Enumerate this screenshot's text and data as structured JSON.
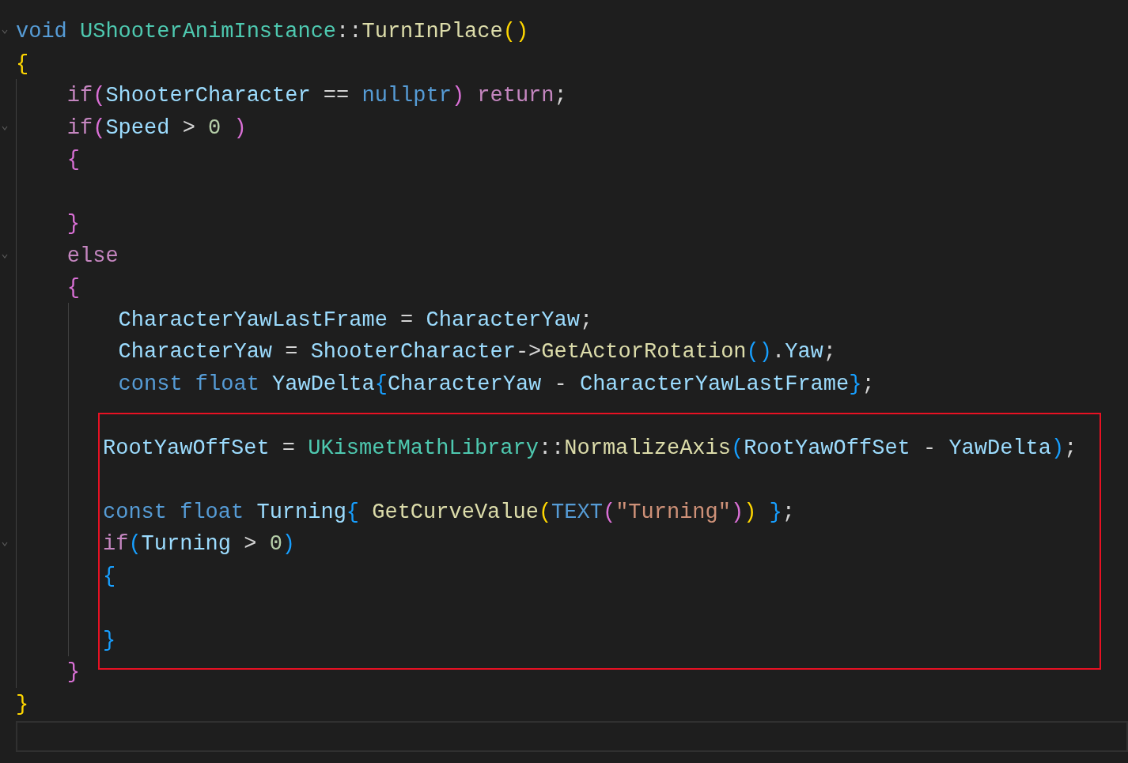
{
  "editor": {
    "sections": [
      {
        "highlighted": false,
        "lines": [
          {
            "fold": true,
            "current": false,
            "tokens": [
              {
                "text": "void ",
                "kind": "keyword"
              },
              {
                "text": "UShooterAnimInstance",
                "kind": "type"
              },
              {
                "text": "::",
                "kind": "plain"
              },
              {
                "text": "TurnInPlace",
                "kind": "function"
              },
              {
                "text": "()",
                "kind": "bracket1"
              }
            ]
          },
          {
            "fold": false,
            "current": false,
            "tokens": [
              {
                "text": "{",
                "kind": "bracket1"
              }
            ]
          },
          {
            "fold": false,
            "current": false,
            "tokens": [
              {
                "text": "    if",
                "kind": "control"
              },
              {
                "text": "(",
                "kind": "bracket2"
              },
              {
                "text": "ShooterCharacter",
                "kind": "variable"
              },
              {
                "text": " == ",
                "kind": "plain"
              },
              {
                "text": "nullptr",
                "kind": "keyword"
              },
              {
                "text": ")",
                "kind": "bracket2"
              },
              {
                "text": " return",
                "kind": "control"
              },
              {
                "text": ";",
                "kind": "plain"
              }
            ]
          },
          {
            "fold": true,
            "current": false,
            "tokens": [
              {
                "text": "    if",
                "kind": "control"
              },
              {
                "text": "(",
                "kind": "bracket2"
              },
              {
                "text": "Speed",
                "kind": "variable"
              },
              {
                "text": " > ",
                "kind": "plain"
              },
              {
                "text": "0",
                "kind": "number"
              },
              {
                "text": " )",
                "kind": "bracket2"
              }
            ]
          },
          {
            "fold": false,
            "current": false,
            "tokens": [
              {
                "text": "    {",
                "kind": "bracket2"
              }
            ]
          },
          {
            "fold": false,
            "current": false
          },
          {
            "fold": false,
            "current": false,
            "tokens": [
              {
                "text": "    }",
                "kind": "bracket2"
              }
            ]
          },
          {
            "fold": true,
            "current": false,
            "tokens": [
              {
                "text": "    else",
                "kind": "control"
              }
            ]
          },
          {
            "fold": false,
            "current": false,
            "tokens": [
              {
                "text": "    {",
                "kind": "bracket2"
              }
            ]
          },
          {
            "fold": false,
            "current": false,
            "tokens": [
              {
                "text": "        CharacterYawLastFrame",
                "kind": "variable"
              },
              {
                "text": " = ",
                "kind": "plain"
              },
              {
                "text": "CharacterYaw",
                "kind": "variable"
              },
              {
                "text": ";",
                "kind": "plain"
              }
            ]
          },
          {
            "fold": false,
            "current": false,
            "tokens": [
              {
                "text": "        CharacterYaw",
                "kind": "variable"
              },
              {
                "text": " = ",
                "kind": "plain"
              },
              {
                "text": "ShooterCharacter",
                "kind": "variable"
              },
              {
                "text": "->",
                "kind": "plain"
              },
              {
                "text": "GetActorRotation",
                "kind": "function"
              },
              {
                "text": "()",
                "kind": "bracket3"
              },
              {
                "text": ".",
                "kind": "plain"
              },
              {
                "text": "Yaw",
                "kind": "variable"
              },
              {
                "text": ";",
                "kind": "plain"
              }
            ]
          },
          {
            "fold": false,
            "current": false,
            "tokens": [
              {
                "text": "        const ",
                "kind": "keyword"
              },
              {
                "text": "float ",
                "kind": "keyword"
              },
              {
                "text": "YawDelta",
                "kind": "variable"
              },
              {
                "text": "{",
                "kind": "bracket3"
              },
              {
                "text": "CharacterYaw",
                "kind": "variable"
              },
              {
                "text": " - ",
                "kind": "plain"
              },
              {
                "text": "CharacterYawLastFrame",
                "kind": "variable"
              },
              {
                "text": "}",
                "kind": "bracket3"
              },
              {
                "text": ";",
                "kind": "plain"
              }
            ]
          }
        ]
      },
      {
        "highlighted": true,
        "lines": [
          {
            "fold": false,
            "current": false
          },
          {
            "fold": false,
            "current": false,
            "tokens": [
              {
                "text": "RootYawOffSet",
                "kind": "variable"
              },
              {
                "text": " = ",
                "kind": "plain"
              },
              {
                "text": "UKismetMathLibrary",
                "kind": "type"
              },
              {
                "text": "::",
                "kind": "plain"
              },
              {
                "text": "NormalizeAxis",
                "kind": "function"
              },
              {
                "text": "(",
                "kind": "bracket3"
              },
              {
                "text": "RootYawOffSet",
                "kind": "variable"
              },
              {
                "text": " - ",
                "kind": "plain"
              },
              {
                "text": "YawDelta",
                "kind": "variable"
              },
              {
                "text": ")",
                "kind": "bracket3"
              },
              {
                "text": ";",
                "kind": "plain"
              }
            ]
          },
          {
            "fold": false,
            "current": false
          },
          {
            "fold": false,
            "current": false,
            "tokens": [
              {
                "text": "const ",
                "kind": "keyword"
              },
              {
                "text": "float ",
                "kind": "keyword"
              },
              {
                "text": "Turning",
                "kind": "variable"
              },
              {
                "text": "{ ",
                "kind": "bracket3"
              },
              {
                "text": "GetCurveValue",
                "kind": "function"
              },
              {
                "text": "(",
                "kind": "bracket1"
              },
              {
                "text": "TEXT",
                "kind": "keyword"
              },
              {
                "text": "(",
                "kind": "bracket2"
              },
              {
                "text": "\"Turning\"",
                "kind": "string"
              },
              {
                "text": ")",
                "kind": "bracket2"
              },
              {
                "text": ")",
                "kind": "bracket1"
              },
              {
                "text": " }",
                "kind": "bracket3"
              },
              {
                "text": ";",
                "kind": "plain"
              }
            ]
          },
          {
            "fold": true,
            "current": false,
            "tokens": [
              {
                "text": "if",
                "kind": "control"
              },
              {
                "text": "(",
                "kind": "bracket3"
              },
              {
                "text": "Turning",
                "kind": "variable"
              },
              {
                "text": " > ",
                "kind": "plain"
              },
              {
                "text": "0",
                "kind": "number"
              },
              {
                "text": ")",
                "kind": "bracket3"
              }
            ]
          },
          {
            "fold": false,
            "current": false,
            "tokens": [
              {
                "text": "{",
                "kind": "bracket3"
              }
            ]
          },
          {
            "fold": false,
            "current": false
          },
          {
            "fold": false,
            "current": false,
            "tokens": [
              {
                "text": "}",
                "kind": "bracket3"
              }
            ]
          }
        ]
      },
      {
        "highlighted": false,
        "lines": [
          {
            "fold": false,
            "current": false,
            "tokens": [
              {
                "text": "    }",
                "kind": "bracket2"
              }
            ]
          },
          {
            "fold": false,
            "current": false,
            "tokens": [
              {
                "text": "}",
                "kind": "bracket1"
              }
            ]
          },
          {
            "fold": false,
            "current": true
          }
        ]
      }
    ]
  }
}
